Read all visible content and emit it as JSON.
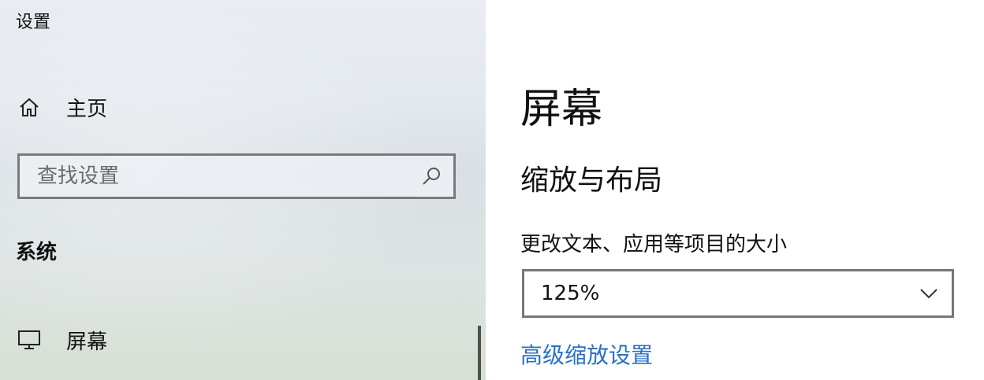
{
  "window": {
    "title": "设置"
  },
  "sidebar": {
    "home": {
      "icon": "home-icon",
      "label": "主页"
    },
    "search": {
      "placeholder": "查找设置",
      "value": "",
      "icon": "search-icon"
    },
    "section_label": "系统",
    "items": [
      {
        "icon": "monitor-icon",
        "label": "屏幕"
      }
    ]
  },
  "main": {
    "page_title": "屏幕",
    "section_heading": "缩放与布局",
    "scale": {
      "label": "更改文本、应用等项目的大小",
      "selected_value": "125%",
      "icon": "chevron-down-icon"
    },
    "advanced_link": "高级缩放设置"
  },
  "colors": {
    "accent_link": "#2a6fc2",
    "border": "#777777"
  }
}
